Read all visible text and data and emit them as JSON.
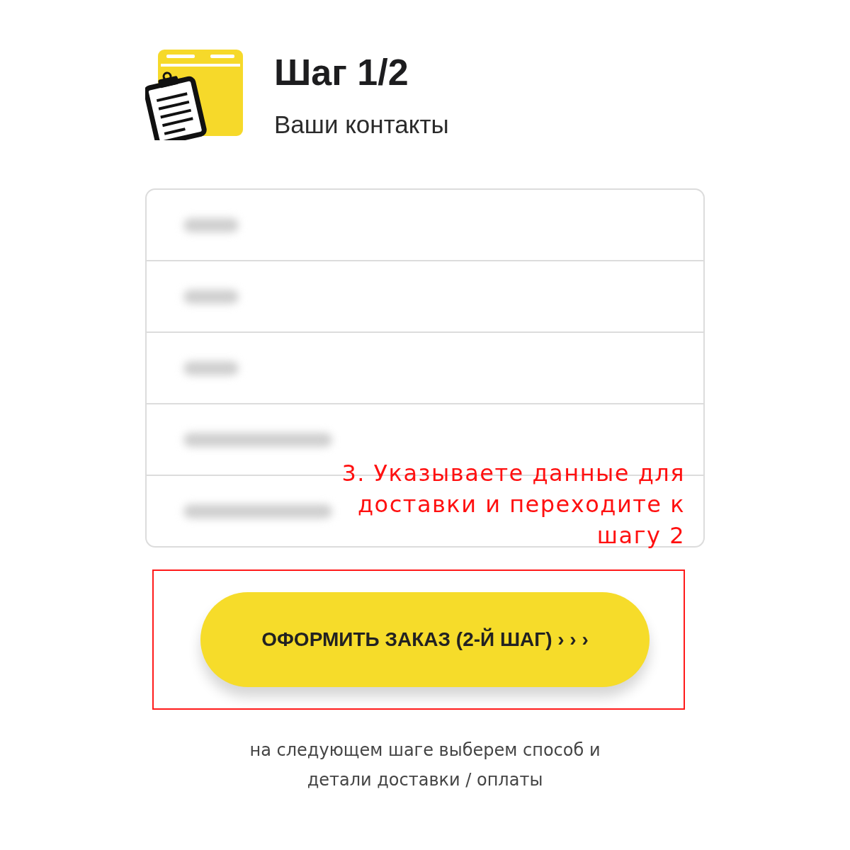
{
  "header": {
    "title": "Шаг 1/2",
    "subtitle": "Ваши контакты"
  },
  "fields": [
    {
      "kind": "short"
    },
    {
      "kind": "short"
    },
    {
      "kind": "short"
    },
    {
      "kind": "long"
    },
    {
      "kind": "long"
    }
  ],
  "annotation": {
    "text": "3. Указываете данные для\nдоставки и переходите к\nшагу 2"
  },
  "submit_button": {
    "label": "ОФОРМИТЬ ЗАКАЗ (2-Й ШАГ) › › ›",
    "highlighted": true
  },
  "footnote": "на следующем шаге выберем способ и\nдетали доставки / оплаты"
}
